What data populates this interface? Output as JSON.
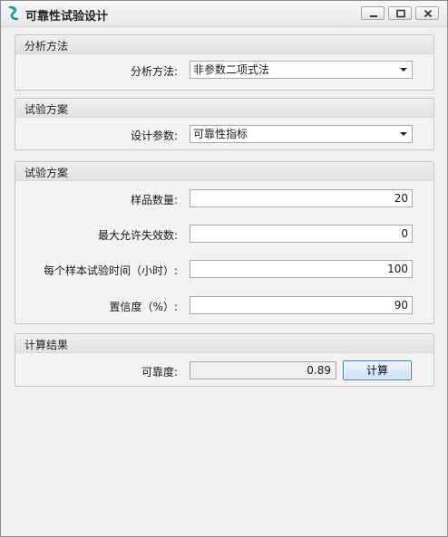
{
  "window": {
    "title": "可靠性试验设计"
  },
  "groups": {
    "analysis": {
      "title": "分析方法",
      "method_label": "分析方法:",
      "method_value": "非参数二项式法"
    },
    "plan": {
      "title": "试验方案",
      "param_label": "设计参数:",
      "param_value": "可靠性指标"
    },
    "params": {
      "title": "试验方案",
      "sample_label": "样品数量:",
      "sample_value": "20",
      "failures_label": "最大允许失效数:",
      "failures_value": "0",
      "time_label": "每个样本试验时间（小时）:",
      "time_value": "100",
      "confidence_label": "置信度（%）:",
      "confidence_value": "90"
    },
    "result": {
      "title": "计算结果",
      "reliability_label": "可靠度:",
      "reliability_value": "0.89",
      "calc_button": "计算"
    }
  },
  "colors": {
    "accent": "#3d7bd6",
    "window_bg": "#f0f0f0"
  }
}
